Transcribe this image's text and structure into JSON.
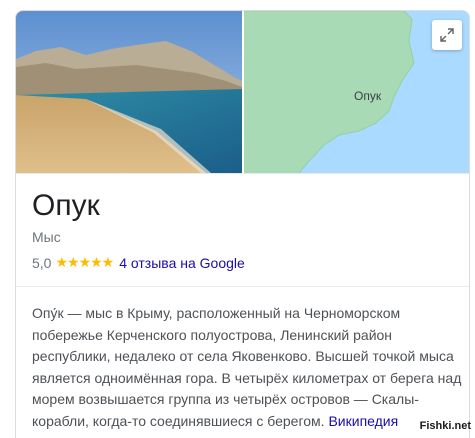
{
  "place": {
    "title": "Опук",
    "type": "Мыс",
    "rating": "5,0",
    "stars_count": 5,
    "stars_text": "★★★★★",
    "reviews_link": "4 отзыва на Google"
  },
  "map": {
    "label": "Опук"
  },
  "description": {
    "text": "Опу́к — мыс в Крыму, расположенный на Черноморском побережье Керченского полуострова, Ленинский район республики, недалеко от села Яковенково. Высшей точкой мыса является одноимённая гора. В четырёх километрах от берега над морем возвышается группа из четырёх островов — Скалы-корабли, когда-то соединявшиеся с берегом.",
    "source_link": "Википедия"
  },
  "watermark": "Fishki.net",
  "colors": {
    "link": "#1a0dab",
    "star": "#fbbc04",
    "water": "#8ab4f8",
    "land": "#a8dab5"
  }
}
